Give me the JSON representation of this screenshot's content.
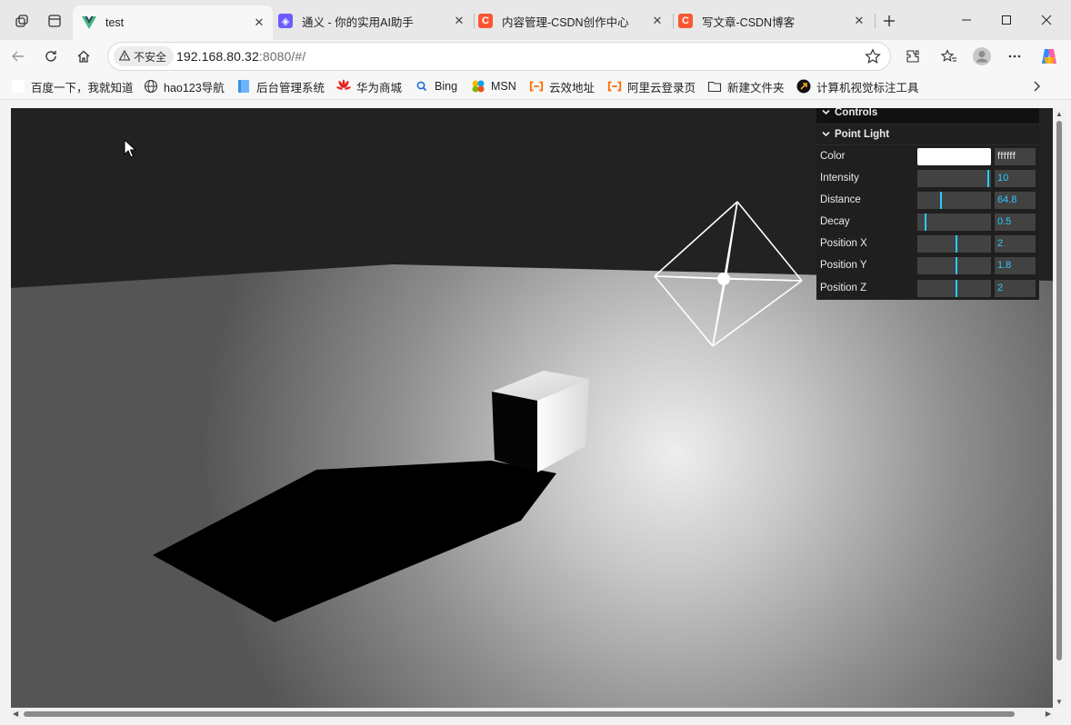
{
  "tabs": [
    {
      "title": "test",
      "favicon": "vue-icon",
      "active": true
    },
    {
      "title": "通义 - 你的实用AI助手",
      "favicon": "tongyi-icon",
      "active": false
    },
    {
      "title": "内容管理-CSDN创作中心",
      "favicon": "csdn-icon",
      "active": false
    },
    {
      "title": "写文章-CSDN博客",
      "favicon": "csdn-icon",
      "active": false
    }
  ],
  "address": {
    "security_label": "不安全",
    "host": "192.168.80.32",
    "rest": ":8080/#/"
  },
  "bookmarks": [
    {
      "label": "百度一下，我就知道",
      "icon": "blank-page-icon"
    },
    {
      "label": "hao123导航",
      "icon": "globe-icon"
    },
    {
      "label": "后台管理系统",
      "icon": "admin-icon"
    },
    {
      "label": "华为商城",
      "icon": "huawei-icon"
    },
    {
      "label": "Bing",
      "icon": "bing-search-icon"
    },
    {
      "label": "MSN",
      "icon": "msn-icon"
    },
    {
      "label": "云效地址",
      "icon": "aliyun-icon"
    },
    {
      "label": "阿里云登录页",
      "icon": "aliyun-icon"
    },
    {
      "label": "新建文件夹",
      "icon": "folder-icon"
    },
    {
      "label": "计算机视觉标注工具",
      "icon": "arrow-circle-icon"
    }
  ],
  "gui": {
    "title": "Controls",
    "folder": "Point Light",
    "color_label": "Color",
    "color_hex": "ffffff",
    "color_value": "#ffffff",
    "controls": [
      {
        "label": "Intensity",
        "value": "10",
        "fraction": 0.98
      },
      {
        "label": "Distance",
        "value": "64.8",
        "fraction": 0.32
      },
      {
        "label": "Decay",
        "value": "0.5",
        "fraction": 0.1
      },
      {
        "label": "Position X",
        "value": "2",
        "fraction": 0.53
      },
      {
        "label": "Position Y",
        "value": "1.8",
        "fraction": 0.53
      },
      {
        "label": "Position Z",
        "value": "2",
        "fraction": 0.53
      }
    ]
  },
  "colors": {
    "accent": "#2cc9ff",
    "gui_bg": "#1f1f1f",
    "csdn": "#fc5531",
    "vue": "#41b883"
  }
}
